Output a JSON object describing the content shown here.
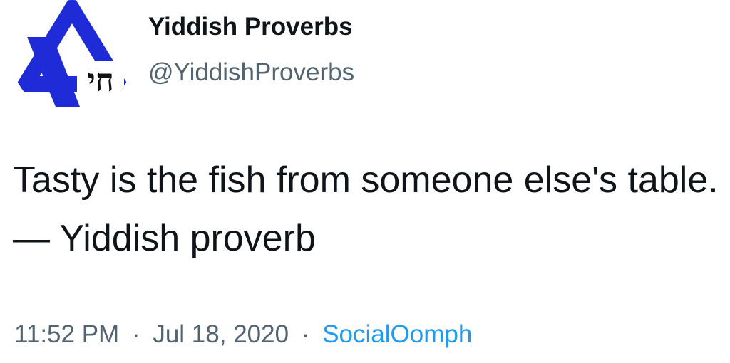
{
  "profile": {
    "display_name": "Yiddish Proverbs",
    "handle": "@YiddishProverbs",
    "avatar_icon": "star-of-david-chai-icon",
    "avatar_text": "חי",
    "brand_color": "#1f2bd6"
  },
  "tweet": {
    "text": "Tasty is the fish from someone else's table. — Yiddish proverb"
  },
  "meta": {
    "time": "11:52 PM",
    "separator": "·",
    "date": "Jul 18, 2020",
    "source": "SocialOomph",
    "text_color": "#536471",
    "link_color": "#1d9bf0"
  }
}
